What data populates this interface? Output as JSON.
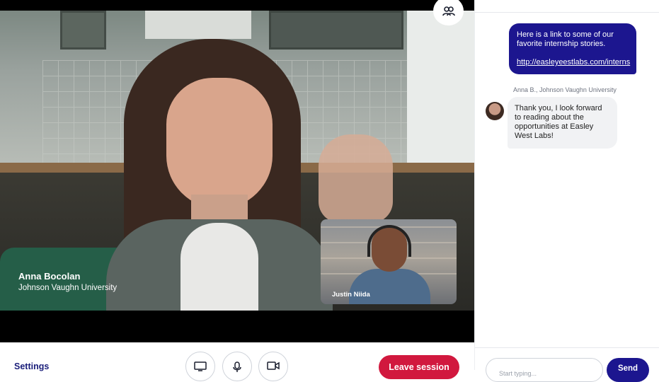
{
  "video": {
    "main_participant": {
      "name": "Anna Bocolan",
      "organization": "Johnson Vaughn University"
    },
    "pip_participant": {
      "name": "Justin Niida"
    },
    "participants_icon": "participants-icon"
  },
  "controls": {
    "settings_label": "Settings",
    "buttons": [
      {
        "name": "screen-share",
        "icon": "monitor-icon"
      },
      {
        "name": "microphone",
        "icon": "microphone-icon"
      },
      {
        "name": "camera",
        "icon": "video-camera-icon"
      }
    ],
    "leave_label": "Leave session",
    "leave_color": "#d1183e"
  },
  "chat": {
    "messages": [
      {
        "direction": "outgoing",
        "text": "Here is a link to some of our favorite internship stories.",
        "link": "http://easleyeestlabs.com/interns"
      },
      {
        "direction": "incoming",
        "sender": "Anna B., Johnson Vaughn University",
        "text": "Thank you, I look forward to reading about the opportunities at Easley West Labs!"
      }
    ],
    "input_placeholder": "Start typing...",
    "send_label": "Send",
    "accent_color": "#1c168f"
  }
}
